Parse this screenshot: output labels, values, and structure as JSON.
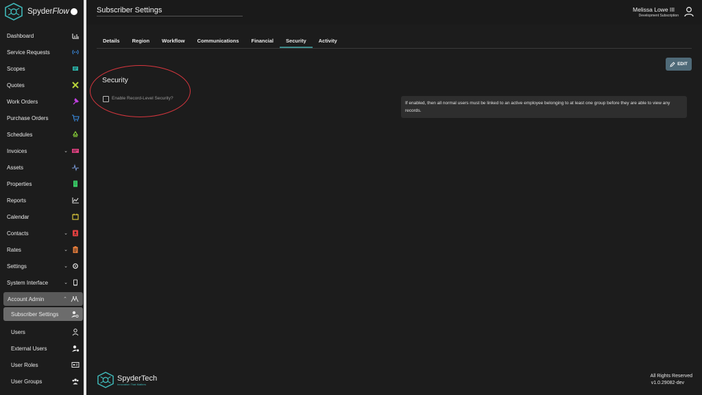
{
  "brand": {
    "name_prefix": "Spyder",
    "name_italic": "Flow"
  },
  "header": {
    "title": "Subscriber Settings",
    "user_name": "Melissa Lowe III",
    "user_subscription": "Development Subscription"
  },
  "sidebar": {
    "items": [
      {
        "label": "Dashboard",
        "icon": "bar-chart-icon",
        "color": "#d8d8d8"
      },
      {
        "label": "Service Requests",
        "icon": "signal-icon",
        "color": "#3a8ee6"
      },
      {
        "label": "Scopes",
        "icon": "scope-box-icon",
        "color": "#2bb3a8"
      },
      {
        "label": "Quotes",
        "icon": "tools-icon",
        "color": "#b8d43a"
      },
      {
        "label": "Work Orders",
        "icon": "hammer-icon",
        "color": "#c040e0"
      },
      {
        "label": "Purchase Orders",
        "icon": "cart-icon",
        "color": "#3a8ee6"
      },
      {
        "label": "Schedules",
        "icon": "recycle-icon",
        "color": "#8ad43a"
      },
      {
        "label": "Invoices",
        "icon": "invoice-icon",
        "color": "#e04080",
        "has_chevron": true
      },
      {
        "label": "Assets",
        "icon": "pulse-icon",
        "color": "#7a9ad8"
      },
      {
        "label": "Properties",
        "icon": "building-icon",
        "color": "#3ad46a"
      },
      {
        "label": "Reports",
        "icon": "line-chart-icon",
        "color": "#d8d8d8"
      },
      {
        "label": "Calendar",
        "icon": "calendar-icon",
        "color": "#d8c43a"
      },
      {
        "label": "Contacts",
        "icon": "contact-card-icon",
        "color": "#e04040",
        "has_chevron": true
      },
      {
        "label": "Rates",
        "icon": "clipboard-icon",
        "color": "#e07a3a",
        "has_chevron": true
      },
      {
        "label": "Settings",
        "icon": "gear-icon",
        "color": "#d8d8d8",
        "has_chevron": true
      },
      {
        "label": "System Interface",
        "icon": "tablet-icon",
        "color": "#d8d8d8",
        "has_chevron": true
      },
      {
        "label": "Account Admin",
        "icon": "users-group-icon",
        "color": "#d8d8d8",
        "has_chevron": true,
        "expanded": true
      }
    ],
    "sub_items": [
      {
        "label": "Subscriber Settings",
        "icon": "user-gear-icon",
        "active": true
      },
      {
        "label": "Users",
        "icon": "user-icon"
      },
      {
        "label": "External Users",
        "icon": "user-cog-icon"
      },
      {
        "label": "User Roles",
        "icon": "id-card-icon"
      },
      {
        "label": "User Groups",
        "icon": "users-icon"
      }
    ]
  },
  "tabs": [
    "Details",
    "Region",
    "Workflow",
    "Communications",
    "Financial",
    "Security",
    "Activity"
  ],
  "active_tab": "Security",
  "edit_label": "EDIT",
  "security": {
    "title": "Security",
    "checkbox_label": "Enable Record-Level Security?",
    "checked": false,
    "info": "If enabled, then all normal users must be linked to an active employee belonging to at least one group before they are able to view any records."
  },
  "footer": {
    "brand": "SpyderTech",
    "tagline": "Innovation That Matters",
    "rights": "All Rights Reserved",
    "version": "v1.0.29082-dev"
  },
  "colors": {
    "accent": "#3d8b8b",
    "edit_button": "#4f6a78",
    "annotation": "#d9363e"
  }
}
